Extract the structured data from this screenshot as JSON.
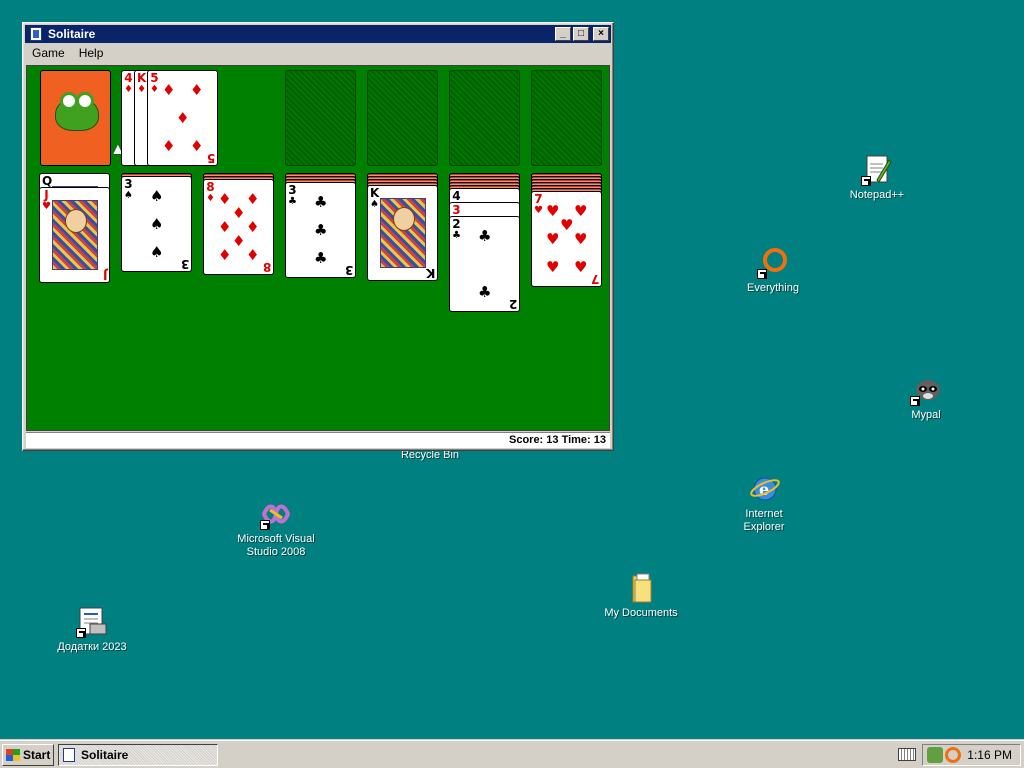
{
  "window": {
    "title": "Solitaire",
    "minimize_glyph": "_",
    "maximize_glyph": "□",
    "close_glyph": "×",
    "menu": [
      "Game",
      "Help"
    ],
    "status": "Score: 13 Time: 13"
  },
  "game": {
    "waste": [
      {
        "rank": "4",
        "suit": "♦",
        "color": "red"
      },
      {
        "rank": "K",
        "suit": "♦",
        "color": "red"
      },
      {
        "rank": "5",
        "suit": "♦",
        "color": "red"
      }
    ],
    "tableau": [
      {
        "hidden": 0,
        "cards": [
          {
            "rank": "Q",
            "suit": "♣",
            "color": "black"
          },
          {
            "rank": "J",
            "suit": "♥",
            "color": "red"
          }
        ]
      },
      {
        "hidden": 1,
        "cards": [
          {
            "rank": "3",
            "suit": "♠",
            "color": "black"
          }
        ]
      },
      {
        "hidden": 2,
        "cards": [
          {
            "rank": "8",
            "suit": "♦",
            "color": "red"
          }
        ]
      },
      {
        "hidden": 3,
        "cards": [
          {
            "rank": "3",
            "suit": "♣",
            "color": "black"
          }
        ]
      },
      {
        "hidden": 4,
        "cards": [
          {
            "rank": "K",
            "suit": "♠",
            "color": "black"
          }
        ]
      },
      {
        "hidden": 5,
        "cards": [
          {
            "rank": "4",
            "suit": "♠",
            "color": "black"
          },
          {
            "rank": "3",
            "suit": "♥",
            "color": "red"
          },
          {
            "rank": "2",
            "suit": "♣",
            "color": "black"
          }
        ]
      },
      {
        "hidden": 6,
        "cards": [
          {
            "rank": "7",
            "suit": "♥",
            "color": "red"
          }
        ]
      }
    ]
  },
  "desktop": {
    "icons": [
      {
        "id": "notepadpp",
        "label": "Notepad++",
        "icon": "notepad-icon"
      },
      {
        "id": "everything",
        "label": "Everything",
        "icon": "search-ring-icon"
      },
      {
        "id": "mypal",
        "label": "Mypal",
        "icon": "raccoon-icon"
      },
      {
        "id": "recycle",
        "label": "Recycle Bin",
        "icon": "recycle-bin-icon"
      },
      {
        "id": "ie",
        "label": "Internet\nExplorer",
        "icon": "internet-explorer-icon"
      },
      {
        "id": "vs2008",
        "label": "Microsoft Visual\nStudio 2008",
        "icon": "visual-studio-icon"
      },
      {
        "id": "mydocs",
        "label": "My Documents",
        "icon": "folder-icon"
      },
      {
        "id": "dodatky",
        "label": "Додатки 2023",
        "icon": "document-icon"
      }
    ]
  },
  "taskbar": {
    "start_label": "Start",
    "task_label": "Solitaire",
    "clock": "1:16 PM"
  },
  "colors": {
    "desktop": "#008080",
    "felt": "#008000",
    "titlebar": "#0a246a",
    "deck_back": "#f06020"
  }
}
